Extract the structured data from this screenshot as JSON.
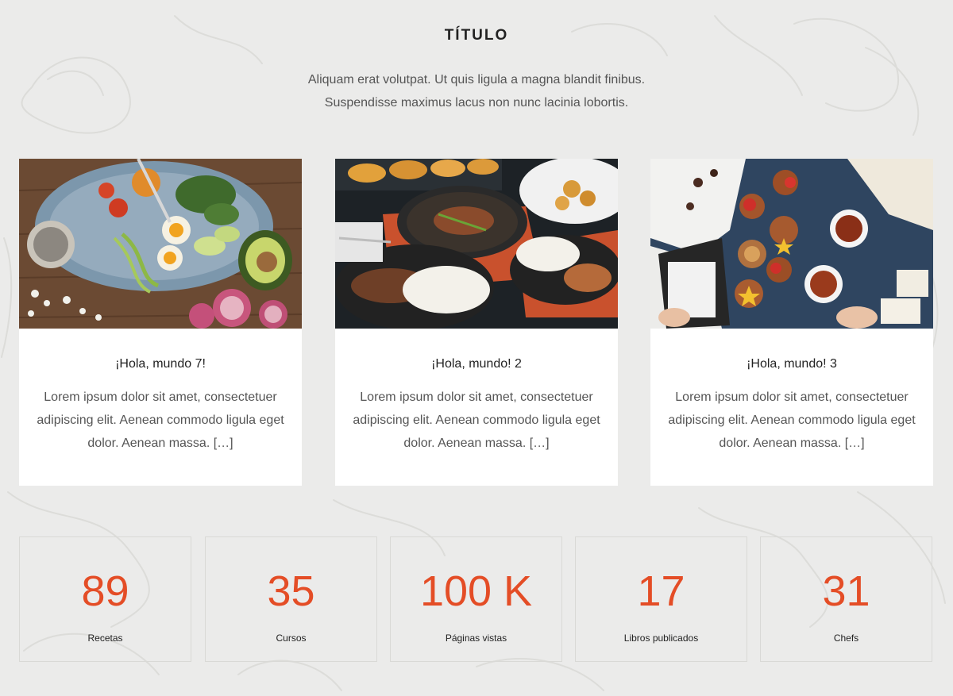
{
  "header": {
    "title": "TÍTULO",
    "subtitle_line1": "Aliquam erat volutpat. Ut quis ligula a magna blandit finibus.",
    "subtitle_line2": "Suspendisse maximus lacus non nunc lacinia lobortis."
  },
  "cards": [
    {
      "image": "salad-bowl-photo",
      "title": "¡Hola, mundo 7!",
      "excerpt": "Lorem ipsum dolor sit amet, consectetuer adipiscing elit. Aenean commodo ligula eget dolor. Aenean massa. […]"
    },
    {
      "image": "seafood-platter-photo",
      "title": "¡Hola, mundo! 2",
      "excerpt": "Lorem ipsum dolor sit amet, consectetuer adipiscing elit. Aenean commodo ligula eget dolor. Aenean massa. […]"
    },
    {
      "image": "breakfast-tea-photo",
      "title": "¡Hola, mundo! 3",
      "excerpt": "Lorem ipsum dolor sit amet, consectetuer adipiscing elit. Aenean commodo ligula eget dolor. Aenean massa. […]"
    }
  ],
  "stats": [
    {
      "value": "89",
      "label": "Recetas"
    },
    {
      "value": "35",
      "label": "Cursos"
    },
    {
      "value": "100 K",
      "label": "Páginas vistas"
    },
    {
      "value": "17",
      "label": "Libros publicados"
    },
    {
      "value": "31",
      "label": "Chefs"
    }
  ],
  "colors": {
    "background": "#ebebea",
    "accent": "#e44d26",
    "card": "#ffffff",
    "text": "#555555"
  }
}
